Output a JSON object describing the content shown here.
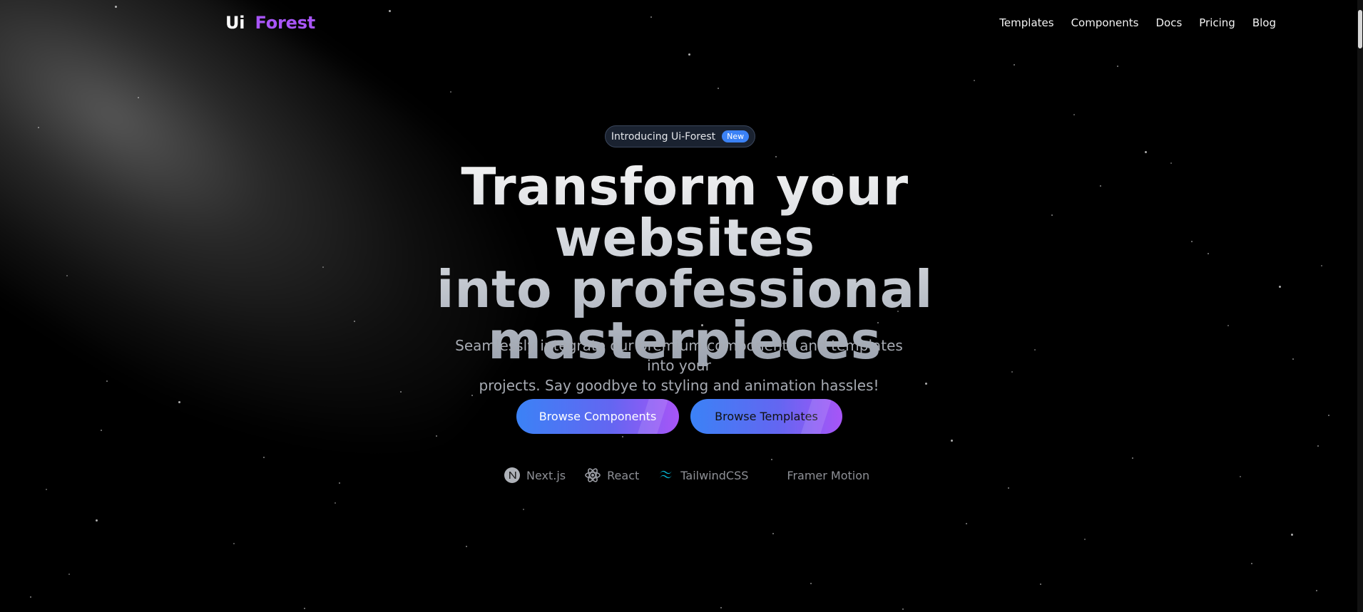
{
  "brand": {
    "logo_left": "Ui",
    "logo_right": "Forest"
  },
  "nav": {
    "items": [
      "Templates",
      "Components",
      "Docs",
      "Pricing",
      "Blog"
    ]
  },
  "hero": {
    "pill_text": "Introducing Ui-Forest",
    "pill_badge": "New",
    "headline_line_1": "Transform your websites",
    "headline_line_2": "into professional",
    "headline_line_3": "masterpieces",
    "subtext_line_1": "Seamlessly integrate our premium components and templates into your",
    "subtext_line_2": "projects. Say goodbye to styling and animation hassles!",
    "primary_button": "Browse Components",
    "secondary_button": "Browse Templates"
  },
  "tech": {
    "items": [
      "Next.js",
      "React",
      "TailwindCSS",
      "Framer Motion"
    ],
    "icons": [
      "next-icon",
      "react-icon",
      "tailwind-icon"
    ]
  },
  "colors": {
    "background": "#000000",
    "accent_purple": "#a855f7",
    "accent_blue": "#3b82f6"
  }
}
